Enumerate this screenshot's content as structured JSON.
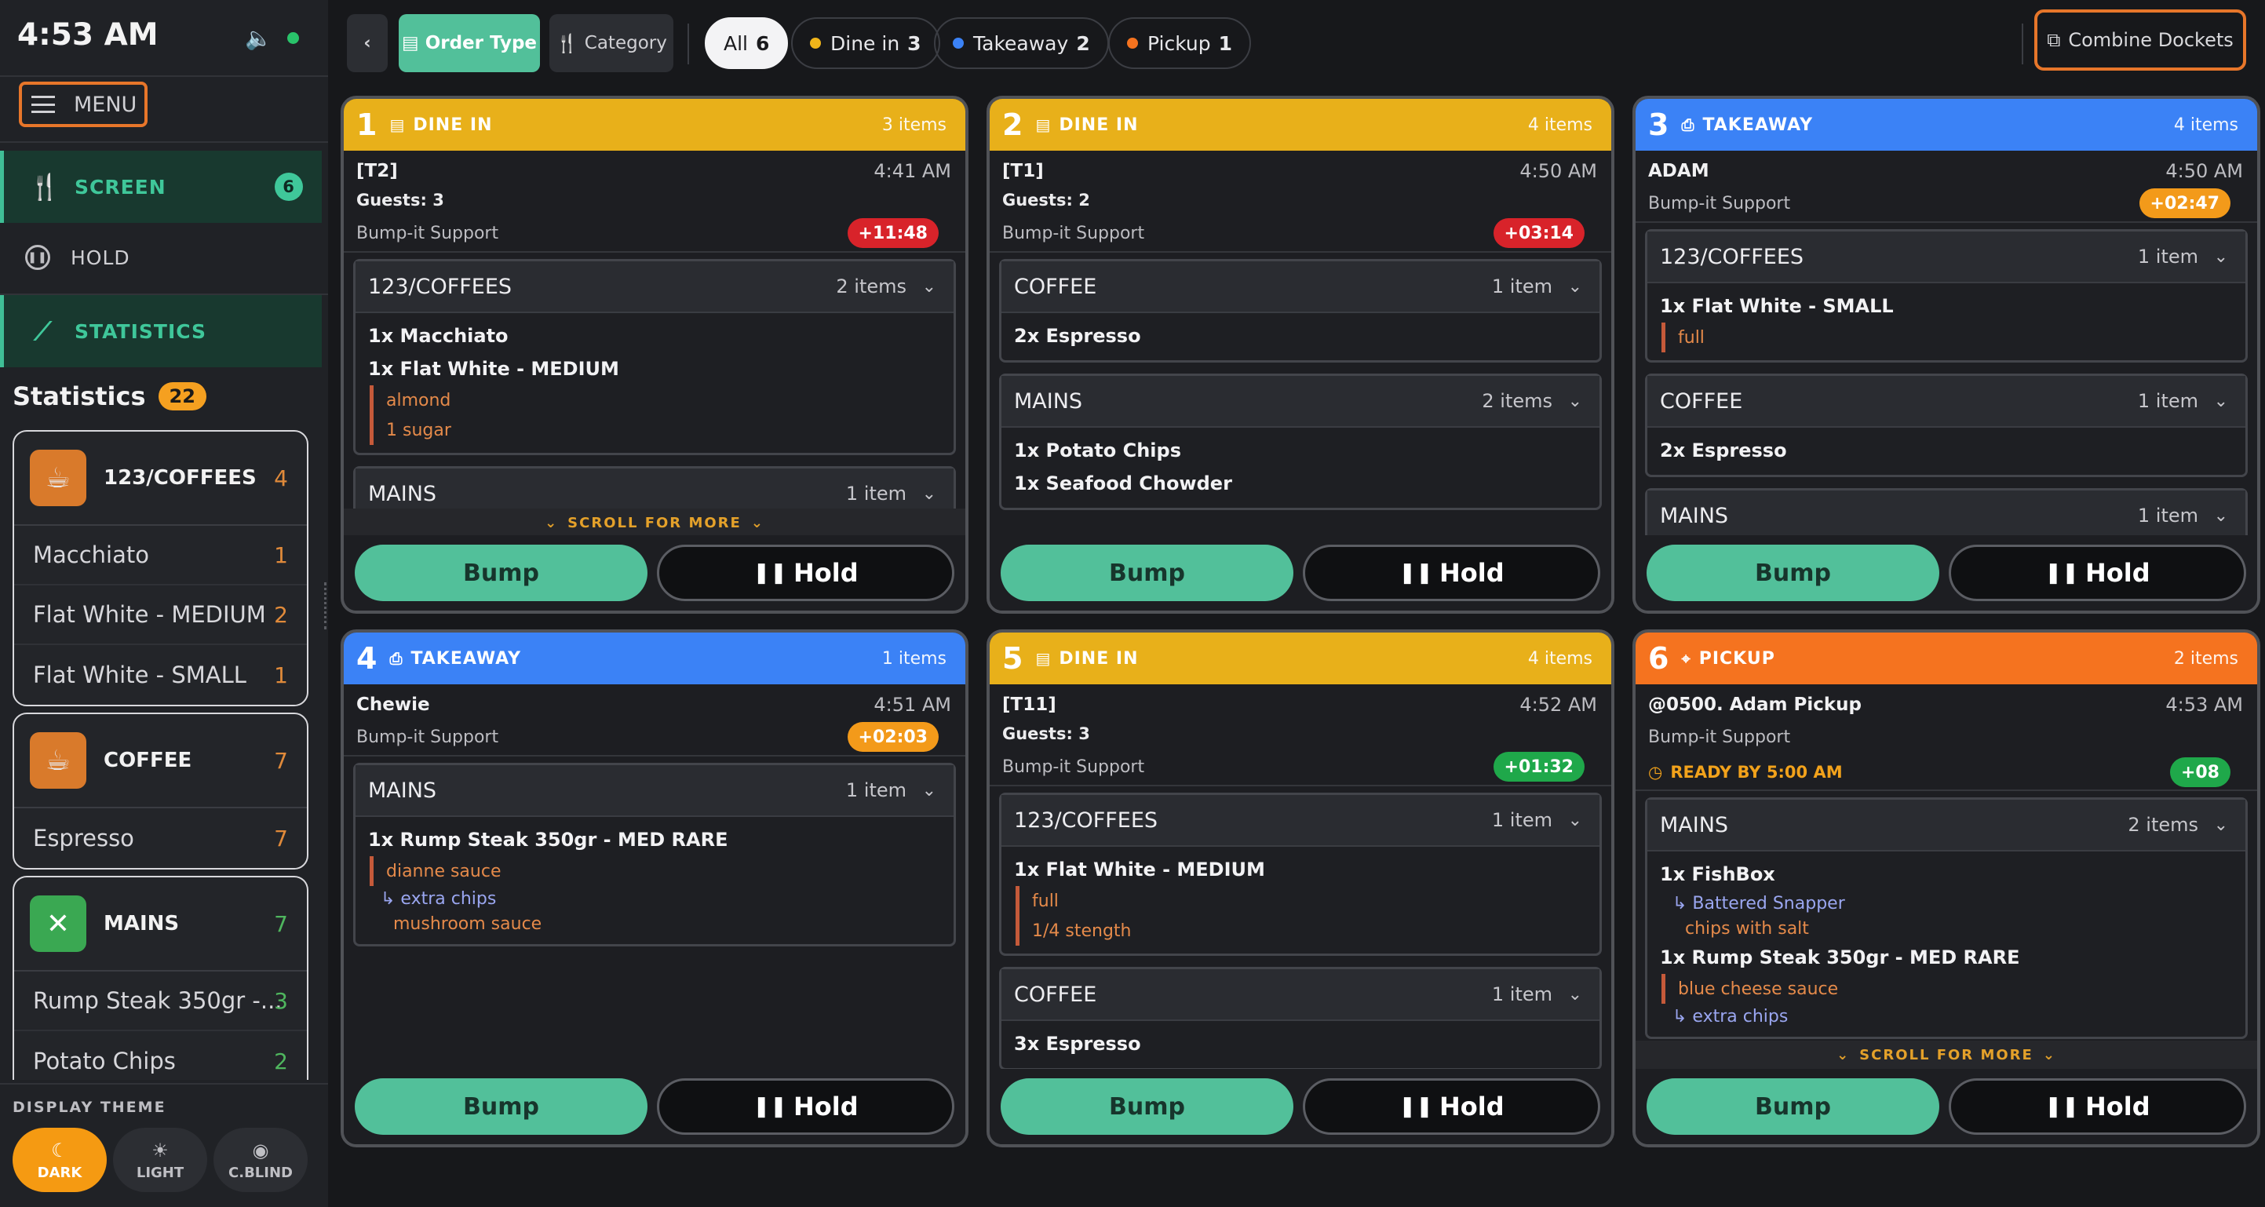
{
  "status": {
    "time": "4:53 AM",
    "speaker_icon": "speaker-icon",
    "connection_color": "#29c36a"
  },
  "menu": {
    "label": "MENU"
  },
  "nav": [
    {
      "label": "SCREEN",
      "count": "6",
      "icon": "utensils-icon",
      "active": true
    },
    {
      "label": "HOLD",
      "icon": "pause-circle-icon",
      "active": false
    },
    {
      "label": "STATISTICS",
      "icon": "trend-line-icon",
      "active": true
    }
  ],
  "statistics": {
    "title": "Statistics",
    "total": "22",
    "cards": [
      {
        "name": "123/COFFEES",
        "count": "4",
        "icon": "coffee-cup-icon",
        "color": "#d97a2b",
        "rows": [
          {
            "label": "Macchiato",
            "n": "1"
          },
          {
            "label": "Flat White - MEDIUM",
            "n": "2"
          },
          {
            "label": "Flat White - SMALL",
            "n": "1"
          }
        ]
      },
      {
        "name": "COFFEE",
        "count": "7",
        "icon": "coffee-cup-icon",
        "color": "#d97a2b",
        "rows": [
          {
            "label": "Espresso",
            "n": "7"
          }
        ]
      },
      {
        "name": "MAINS",
        "count": "7",
        "icon": "fork-knife-icon",
        "color": "#3aa852",
        "rows": [
          {
            "label": "Rump Steak 350gr -...",
            "n": "3"
          },
          {
            "label": "Potato Chips",
            "n": "2"
          }
        ]
      }
    ]
  },
  "theme": {
    "label": "DISPLAY THEME",
    "options": [
      {
        "label": "DARK",
        "icon": "moon-icon"
      },
      {
        "label": "LIGHT",
        "icon": "sun-icon"
      },
      {
        "label": "C.BLIND",
        "icon": "eye-icon"
      }
    ]
  },
  "toolbar": {
    "back_icon": "chevron-left-icon",
    "order_type": "Order Type",
    "category": "Category",
    "filters": [
      {
        "label": "All",
        "count": "6",
        "color": ""
      },
      {
        "label": "Dine in",
        "count": "3",
        "color": "#f0b51a"
      },
      {
        "label": "Takeaway",
        "count": "2",
        "color": "#3b82f6"
      },
      {
        "label": "Pickup",
        "count": "1",
        "color": "#f5731f"
      }
    ],
    "combine": "Combine Dockets"
  },
  "tickets": [
    {
      "num": "1",
      "type": "DINE IN",
      "items_count": "3 items",
      "color": "#e8b01a",
      "table": "[T2]",
      "time": "4:41 AM",
      "guests_label": "Guests:",
      "guests": "3",
      "support": "Bump-it Support",
      "timer": "+11:48",
      "timer_color": "#d8232a",
      "groups": [
        {
          "name": "123/COFFEES",
          "count": "2 items",
          "items": [
            {
              "t": "item",
              "v": "1x Macchiato"
            },
            {
              "t": "item",
              "v": "1x Flat White - MEDIUM"
            },
            {
              "t": "mod",
              "v": "almond"
            },
            {
              "t": "mod",
              "v": "1 sugar"
            }
          ]
        },
        {
          "name": "MAINS",
          "count": "1 item",
          "items": []
        }
      ],
      "scroll": "SCROLL FOR MORE"
    },
    {
      "num": "2",
      "type": "DINE IN",
      "items_count": "4 items",
      "color": "#e8b01a",
      "table": "[T1]",
      "time": "4:50 AM",
      "guests_label": "Guests:",
      "guests": "2",
      "support": "Bump-it Support",
      "timer": "+03:14",
      "timer_color": "#d8232a",
      "groups": [
        {
          "name": "COFFEE",
          "count": "1 item",
          "items": [
            {
              "t": "item",
              "v": "2x Espresso"
            }
          ]
        },
        {
          "name": "MAINS",
          "count": "2 items",
          "items": [
            {
              "t": "item",
              "v": "1x Potato Chips"
            },
            {
              "t": "item",
              "v": "1x Seafood Chowder"
            }
          ]
        }
      ]
    },
    {
      "num": "3",
      "type": "TAKEAWAY",
      "items_count": "4 items",
      "color": "#3b82f6",
      "table": "ADAM",
      "time": "4:50 AM",
      "support": "Bump-it Support",
      "timer": "+02:47",
      "timer_color": "#f39a1a",
      "groups": [
        {
          "name": "123/COFFEES",
          "count": "1 item",
          "items": [
            {
              "t": "item",
              "v": "1x Flat White - SMALL"
            },
            {
              "t": "mod",
              "v": "full"
            }
          ]
        },
        {
          "name": "COFFEE",
          "count": "1 item",
          "items": [
            {
              "t": "item",
              "v": "2x Espresso"
            }
          ]
        },
        {
          "name": "MAINS",
          "count": "1 item",
          "items": []
        }
      ]
    },
    {
      "num": "4",
      "type": "TAKEAWAY",
      "items_count": "1 items",
      "color": "#3b82f6",
      "table": "Chewie",
      "time": "4:51 AM",
      "support": "Bump-it Support",
      "timer": "+02:03",
      "timer_color": "#f39a1a",
      "groups": [
        {
          "name": "MAINS",
          "count": "1 item",
          "items": [
            {
              "t": "item",
              "v": "1x Rump Steak 350gr - MED RARE"
            },
            {
              "t": "mod",
              "v": "dianne sauce"
            },
            {
              "t": "sub",
              "v": "↳ extra chips"
            },
            {
              "t": "plain",
              "v": "mushroom sauce"
            }
          ]
        }
      ]
    },
    {
      "num": "5",
      "type": "DINE IN",
      "items_count": "4 items",
      "color": "#e8b01a",
      "table": "[T11]",
      "time": "4:52 AM",
      "guests_label": "Guests:",
      "guests": "3",
      "support": "Bump-it Support",
      "timer": "+01:32",
      "timer_color": "#1fa84a",
      "groups": [
        {
          "name": "123/COFFEES",
          "count": "1 item",
          "items": [
            {
              "t": "item",
              "v": "1x Flat White - MEDIUM"
            },
            {
              "t": "mod",
              "v": "full"
            },
            {
              "t": "mod",
              "v": "1/4 stength"
            }
          ]
        },
        {
          "name": "COFFEE",
          "count": "1 item",
          "items": [
            {
              "t": "item",
              "v": "3x Espresso"
            }
          ]
        }
      ]
    },
    {
      "num": "6",
      "type": "PICKUP",
      "items_count": "2 items",
      "color": "#f5731f",
      "table": "@0500. Adam Pickup",
      "time": "4:53 AM",
      "support": "Bump-it Support",
      "ready": "READY BY 5:00 AM",
      "timer": "+08",
      "timer_color": "#1fa84a",
      "groups": [
        {
          "name": "MAINS",
          "count": "2 items",
          "items": [
            {
              "t": "item",
              "v": "1x FishBox"
            },
            {
              "t": "sub",
              "v": "↳ Battered Snapper"
            },
            {
              "t": "plain",
              "v": "chips with salt"
            },
            {
              "t": "item",
              "v": "1x Rump Steak 350gr - MED RARE"
            },
            {
              "t": "mod",
              "v": "blue cheese sauce"
            },
            {
              "t": "sub",
              "v": "↳ extra chips"
            }
          ]
        }
      ],
      "scroll": "SCROLL FOR MORE"
    }
  ],
  "actions": {
    "bump": "Bump",
    "hold": "Hold"
  }
}
